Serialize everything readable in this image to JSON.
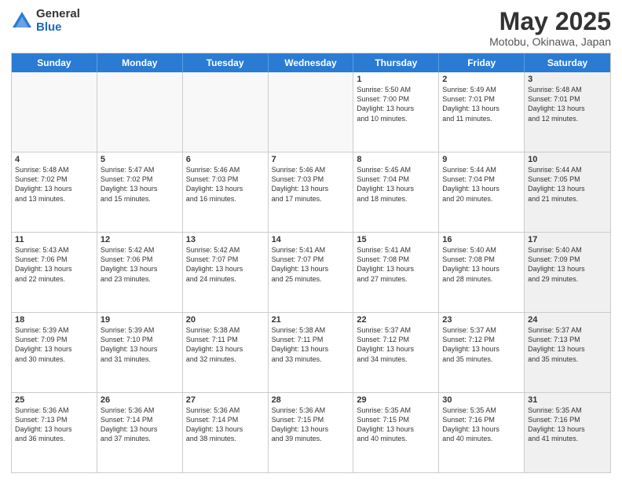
{
  "logo": {
    "general": "General",
    "blue": "Blue"
  },
  "title": "May 2025",
  "subtitle": "Motobu, Okinawa, Japan",
  "header_days": [
    "Sunday",
    "Monday",
    "Tuesday",
    "Wednesday",
    "Thursday",
    "Friday",
    "Saturday"
  ],
  "weeks": [
    [
      {
        "day": "",
        "lines": [],
        "empty": true
      },
      {
        "day": "",
        "lines": [],
        "empty": true
      },
      {
        "day": "",
        "lines": [],
        "empty": true
      },
      {
        "day": "",
        "lines": [],
        "empty": true
      },
      {
        "day": "1",
        "lines": [
          "Sunrise: 5:50 AM",
          "Sunset: 7:00 PM",
          "Daylight: 13 hours",
          "and 10 minutes."
        ]
      },
      {
        "day": "2",
        "lines": [
          "Sunrise: 5:49 AM",
          "Sunset: 7:01 PM",
          "Daylight: 13 hours",
          "and 11 minutes."
        ]
      },
      {
        "day": "3",
        "lines": [
          "Sunrise: 5:48 AM",
          "Sunset: 7:01 PM",
          "Daylight: 13 hours",
          "and 12 minutes."
        ],
        "shaded": true
      }
    ],
    [
      {
        "day": "4",
        "lines": [
          "Sunrise: 5:48 AM",
          "Sunset: 7:02 PM",
          "Daylight: 13 hours",
          "and 13 minutes."
        ]
      },
      {
        "day": "5",
        "lines": [
          "Sunrise: 5:47 AM",
          "Sunset: 7:02 PM",
          "Daylight: 13 hours",
          "and 15 minutes."
        ]
      },
      {
        "day": "6",
        "lines": [
          "Sunrise: 5:46 AM",
          "Sunset: 7:03 PM",
          "Daylight: 13 hours",
          "and 16 minutes."
        ]
      },
      {
        "day": "7",
        "lines": [
          "Sunrise: 5:46 AM",
          "Sunset: 7:03 PM",
          "Daylight: 13 hours",
          "and 17 minutes."
        ]
      },
      {
        "day": "8",
        "lines": [
          "Sunrise: 5:45 AM",
          "Sunset: 7:04 PM",
          "Daylight: 13 hours",
          "and 18 minutes."
        ]
      },
      {
        "day": "9",
        "lines": [
          "Sunrise: 5:44 AM",
          "Sunset: 7:04 PM",
          "Daylight: 13 hours",
          "and 20 minutes."
        ]
      },
      {
        "day": "10",
        "lines": [
          "Sunrise: 5:44 AM",
          "Sunset: 7:05 PM",
          "Daylight: 13 hours",
          "and 21 minutes."
        ],
        "shaded": true
      }
    ],
    [
      {
        "day": "11",
        "lines": [
          "Sunrise: 5:43 AM",
          "Sunset: 7:06 PM",
          "Daylight: 13 hours",
          "and 22 minutes."
        ]
      },
      {
        "day": "12",
        "lines": [
          "Sunrise: 5:42 AM",
          "Sunset: 7:06 PM",
          "Daylight: 13 hours",
          "and 23 minutes."
        ]
      },
      {
        "day": "13",
        "lines": [
          "Sunrise: 5:42 AM",
          "Sunset: 7:07 PM",
          "Daylight: 13 hours",
          "and 24 minutes."
        ]
      },
      {
        "day": "14",
        "lines": [
          "Sunrise: 5:41 AM",
          "Sunset: 7:07 PM",
          "Daylight: 13 hours",
          "and 25 minutes."
        ]
      },
      {
        "day": "15",
        "lines": [
          "Sunrise: 5:41 AM",
          "Sunset: 7:08 PM",
          "Daylight: 13 hours",
          "and 27 minutes."
        ]
      },
      {
        "day": "16",
        "lines": [
          "Sunrise: 5:40 AM",
          "Sunset: 7:08 PM",
          "Daylight: 13 hours",
          "and 28 minutes."
        ]
      },
      {
        "day": "17",
        "lines": [
          "Sunrise: 5:40 AM",
          "Sunset: 7:09 PM",
          "Daylight: 13 hours",
          "and 29 minutes."
        ],
        "shaded": true
      }
    ],
    [
      {
        "day": "18",
        "lines": [
          "Sunrise: 5:39 AM",
          "Sunset: 7:09 PM",
          "Daylight: 13 hours",
          "and 30 minutes."
        ]
      },
      {
        "day": "19",
        "lines": [
          "Sunrise: 5:39 AM",
          "Sunset: 7:10 PM",
          "Daylight: 13 hours",
          "and 31 minutes."
        ]
      },
      {
        "day": "20",
        "lines": [
          "Sunrise: 5:38 AM",
          "Sunset: 7:11 PM",
          "Daylight: 13 hours",
          "and 32 minutes."
        ]
      },
      {
        "day": "21",
        "lines": [
          "Sunrise: 5:38 AM",
          "Sunset: 7:11 PM",
          "Daylight: 13 hours",
          "and 33 minutes."
        ]
      },
      {
        "day": "22",
        "lines": [
          "Sunrise: 5:37 AM",
          "Sunset: 7:12 PM",
          "Daylight: 13 hours",
          "and 34 minutes."
        ]
      },
      {
        "day": "23",
        "lines": [
          "Sunrise: 5:37 AM",
          "Sunset: 7:12 PM",
          "Daylight: 13 hours",
          "and 35 minutes."
        ]
      },
      {
        "day": "24",
        "lines": [
          "Sunrise: 5:37 AM",
          "Sunset: 7:13 PM",
          "Daylight: 13 hours",
          "and 35 minutes."
        ],
        "shaded": true
      }
    ],
    [
      {
        "day": "25",
        "lines": [
          "Sunrise: 5:36 AM",
          "Sunset: 7:13 PM",
          "Daylight: 13 hours",
          "and 36 minutes."
        ]
      },
      {
        "day": "26",
        "lines": [
          "Sunrise: 5:36 AM",
          "Sunset: 7:14 PM",
          "Daylight: 13 hours",
          "and 37 minutes."
        ]
      },
      {
        "day": "27",
        "lines": [
          "Sunrise: 5:36 AM",
          "Sunset: 7:14 PM",
          "Daylight: 13 hours",
          "and 38 minutes."
        ]
      },
      {
        "day": "28",
        "lines": [
          "Sunrise: 5:36 AM",
          "Sunset: 7:15 PM",
          "Daylight: 13 hours",
          "and 39 minutes."
        ]
      },
      {
        "day": "29",
        "lines": [
          "Sunrise: 5:35 AM",
          "Sunset: 7:15 PM",
          "Daylight: 13 hours",
          "and 40 minutes."
        ]
      },
      {
        "day": "30",
        "lines": [
          "Sunrise: 5:35 AM",
          "Sunset: 7:16 PM",
          "Daylight: 13 hours",
          "and 40 minutes."
        ]
      },
      {
        "day": "31",
        "lines": [
          "Sunrise: 5:35 AM",
          "Sunset: 7:16 PM",
          "Daylight: 13 hours",
          "and 41 minutes."
        ],
        "shaded": true
      }
    ]
  ]
}
